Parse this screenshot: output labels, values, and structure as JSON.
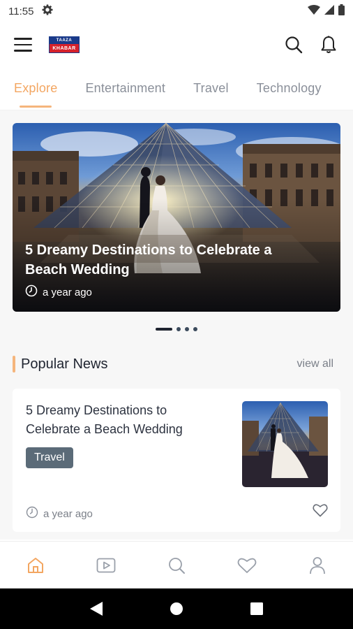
{
  "status_bar": {
    "time": "11:55",
    "icons": [
      "settings-icon",
      "wifi-icon",
      "signal-icon",
      "battery-icon"
    ]
  },
  "header": {
    "logo_top": "TAAZA",
    "logo_bottom": "KHABAR",
    "icons": [
      "menu-icon",
      "search-icon",
      "bell-icon"
    ]
  },
  "tabs": [
    {
      "label": "Explore",
      "active": true
    },
    {
      "label": "Entertainment",
      "active": false
    },
    {
      "label": "Travel",
      "active": false
    },
    {
      "label": "Technology",
      "active": false
    }
  ],
  "hero": {
    "title": "5 Dreamy Destinations to Celebrate a Beach Wedding",
    "time": "a year ago"
  },
  "carousel": {
    "count": 4,
    "active_index": 0
  },
  "popular_news": {
    "heading": "Popular News",
    "view_all": "view all",
    "items": [
      {
        "title": "5 Dreamy Destinations to Celebrate a Beach Wedding",
        "tag": "Travel",
        "time": "a year ago"
      }
    ]
  },
  "bottom_nav": {
    "items": [
      "home-icon",
      "video-icon",
      "search-icon",
      "heart-icon",
      "profile-icon"
    ],
    "active": "home-icon"
  },
  "colors": {
    "accent": "#f3a661",
    "tag_bg": "#5b6b78",
    "text_dark": "#1f2430"
  }
}
